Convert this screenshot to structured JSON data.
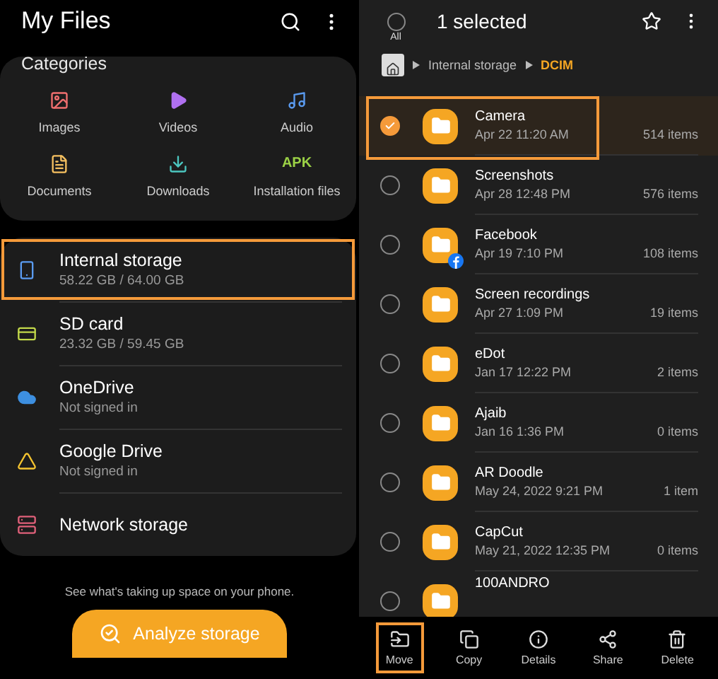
{
  "left_screen": {
    "title": "My Files",
    "categories": {
      "heading": "Categories",
      "items": [
        {
          "kind": "images",
          "label": "Images"
        },
        {
          "kind": "videos",
          "label": "Videos"
        },
        {
          "kind": "audio",
          "label": "Audio"
        },
        {
          "kind": "documents",
          "label": "Documents"
        },
        {
          "kind": "downloads",
          "label": "Downloads"
        },
        {
          "kind": "apk",
          "label": "Installation files",
          "icon_text": "APK"
        }
      ]
    },
    "storage": [
      {
        "kind": "phone",
        "name": "Internal storage",
        "detail": "58.22 GB / 64.00 GB",
        "highlighted": true
      },
      {
        "kind": "sdcard",
        "name": "SD card",
        "detail": "23.32 GB / 59.45 GB",
        "highlighted": false
      },
      {
        "kind": "cloud",
        "name": "OneDrive",
        "detail": "Not signed in",
        "highlighted": false
      },
      {
        "kind": "drive",
        "name": "Google Drive",
        "detail": "Not signed in",
        "highlighted": false
      },
      {
        "kind": "network",
        "name": "Network storage",
        "highlighted": false
      }
    ],
    "hint": "See what's taking up space on your phone.",
    "analyze_button": "Analyze storage"
  },
  "right_screen": {
    "title": "1 selected",
    "all_label": "All",
    "all_checked": false,
    "breadcrumb": [
      {
        "label": "Internal storage",
        "current": false
      },
      {
        "label": "DCIM",
        "current": true
      }
    ],
    "folders": [
      {
        "name": "Camera",
        "date": "Apr 22 11:20 AM",
        "count": "514 items",
        "selected": true,
        "highlighted": true,
        "badge": false
      },
      {
        "name": "Screenshots",
        "date": "Apr 28 12:48 PM",
        "count": "576 items",
        "selected": false,
        "highlighted": false,
        "badge": false
      },
      {
        "name": "Facebook",
        "date": "Apr 19 7:10 PM",
        "count": "108 items",
        "selected": false,
        "highlighted": false,
        "badge": true
      },
      {
        "name": "Screen recordings",
        "date": "Apr 27 1:09 PM",
        "count": "19 items",
        "selected": false,
        "highlighted": false,
        "badge": false
      },
      {
        "name": "eDot",
        "date": "Jan 17 12:22 PM",
        "count": "2 items",
        "selected": false,
        "highlighted": false,
        "badge": false
      },
      {
        "name": "Ajaib",
        "date": "Jan 16 1:36 PM",
        "count": "0 items",
        "selected": false,
        "highlighted": false,
        "badge": false
      },
      {
        "name": "AR Doodle",
        "date": "May 24, 2022 9:21 PM",
        "count": "1 item",
        "selected": false,
        "highlighted": false,
        "badge": false
      },
      {
        "name": "CapCut",
        "date": "May 21, 2022 12:35 PM",
        "count": "0 items",
        "selected": false,
        "highlighted": false,
        "badge": false
      },
      {
        "name": "100ANDRO",
        "selected": false,
        "highlighted": false,
        "badge": false
      }
    ],
    "actions": [
      {
        "kind": "move",
        "label": "Move",
        "highlighted": true
      },
      {
        "kind": "copy",
        "label": "Copy",
        "highlighted": false
      },
      {
        "kind": "details",
        "label": "Details",
        "highlighted": false
      },
      {
        "kind": "share",
        "label": "Share",
        "highlighted": false
      },
      {
        "kind": "delete",
        "label": "Delete",
        "highlighted": false
      }
    ]
  }
}
